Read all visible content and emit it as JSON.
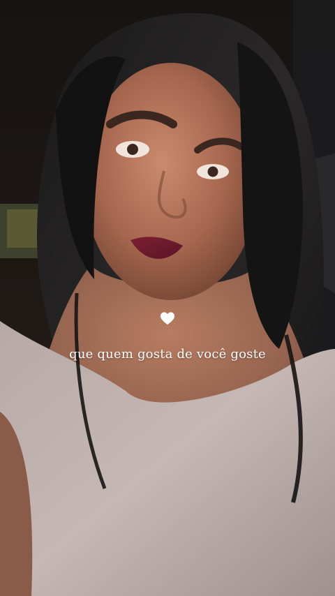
{
  "story": {
    "caption": "que quem gosta de você goste",
    "sticker": "heart-icon"
  },
  "colors": {
    "caption_text": "#ffffff",
    "heart": "#ffffff"
  }
}
